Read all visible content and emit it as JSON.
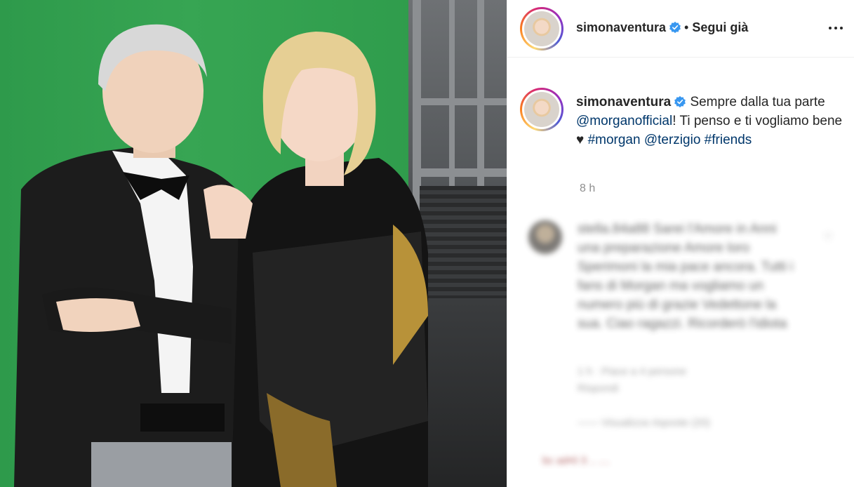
{
  "post": {
    "image_alt": "Foto del post"
  },
  "header": {
    "username": "simonaventura",
    "separator": "•",
    "follow_state": "Segui già"
  },
  "caption": {
    "username": "simonaventura",
    "text_part1": "Sempre dalla tua parte ",
    "mention_1": "@morganofficial",
    "text_part2": "! Ti penso e ti vogliamo bene ♥ ",
    "hashtag_1": "#morgan",
    "space": " ",
    "mention_2": "@terzigio",
    "hashtag_2": "#friends"
  },
  "timestamp": "8 h",
  "blurred_comment": {
    "text": "stella.84a88 Sarei l'Amore in Anni una preparazione Amore loro Sperimoni la mia pace ancora. Tutti i fans di Morgan ma vogliamo un numero più di grazie Vedettone la sua. Ciao ragazzi. Ricorderò l'idiota",
    "meta_line1": "1 h · Piace a 4 persone",
    "meta_line2": "Rispondi",
    "replies": "—— Visualizza risposte (20)",
    "next": "bc ad•0 3 .. ...."
  },
  "colors": {
    "link": "#00376b",
    "verified": "#3897f0",
    "text": "#262626",
    "muted": "#8e8e8e"
  }
}
